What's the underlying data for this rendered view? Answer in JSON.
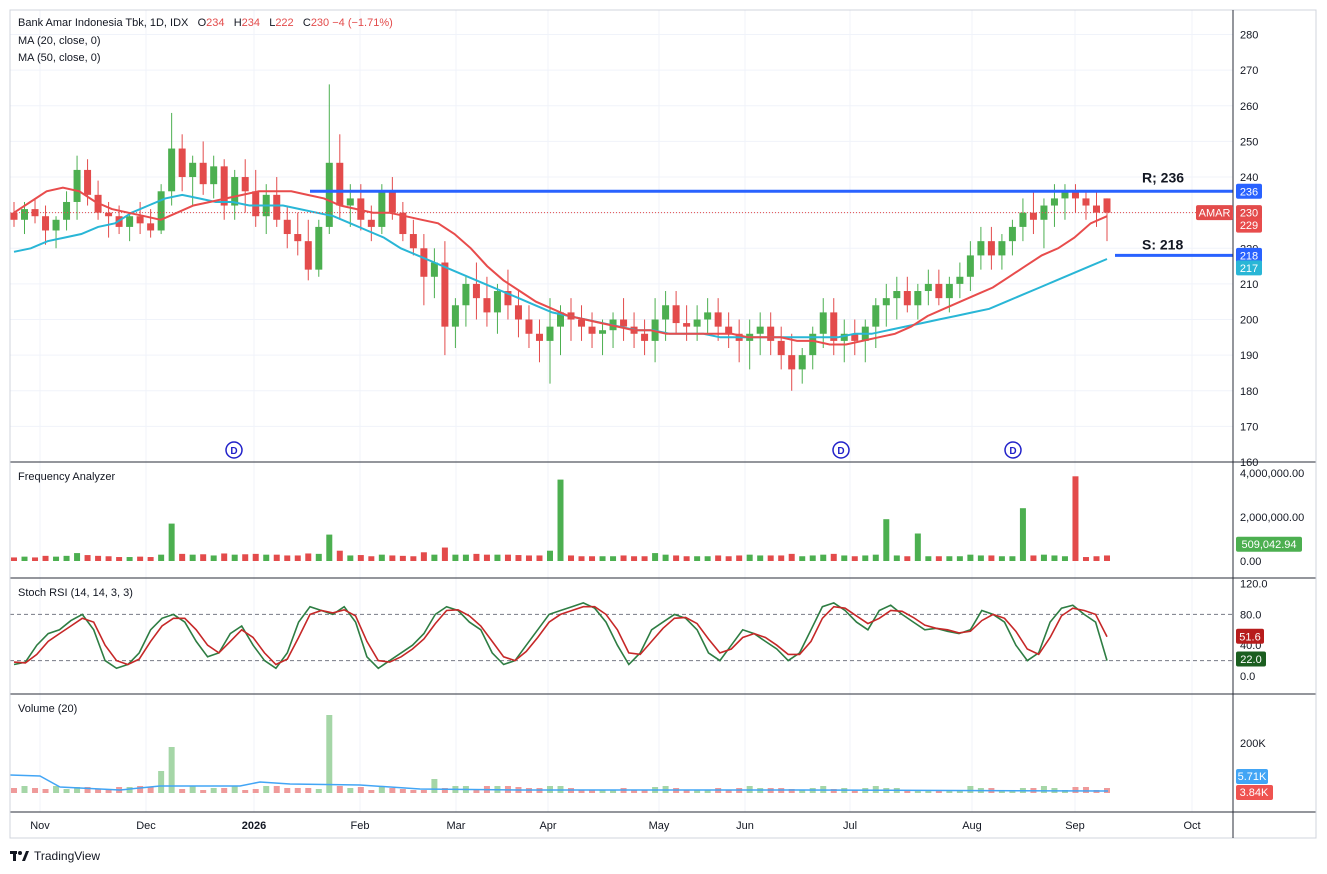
{
  "header": {
    "symbol_line": "Bank Amar Indonesia Tbk, 1D, IDX",
    "ohlc": [
      {
        "label": "O",
        "value": "234"
      },
      {
        "label": "H",
        "value": "234"
      },
      {
        "label": "L",
        "value": "222"
      },
      {
        "label": "C",
        "value": "230"
      }
    ],
    "change": "−4 (−1.71%)",
    "ma20_label": "MA (20, close, 0)",
    "ma50_label": "MA (50, close, 0)"
  },
  "panes": {
    "frequency_title": "Frequency Analyzer",
    "stoch_title": "Stoch RSI (14, 14, 3, 3)",
    "volume_title": "Volume (20)"
  },
  "brand": "TradingView",
  "colors": {
    "up": "#4caf50",
    "down": "#e34b4b",
    "ma20": "#e84c4c",
    "ma50": "#29b6d6",
    "level": "#2962ff",
    "stoch_k": "#2e7d43",
    "stoch_d": "#c62828",
    "vol_up": "#a5d6a7",
    "vol_down": "#ef9a9a"
  },
  "chart_data": {
    "type": "candlestick",
    "symbol": "AMAR",
    "x_ticks": [
      "Nov",
      "Dec",
      "2026",
      "Feb",
      "Mar",
      "Apr",
      "May",
      "Jun",
      "Jul",
      "Aug",
      "Sep",
      "Oct"
    ],
    "price_axis_ticks": [
      "280",
      "270",
      "260",
      "250",
      "240",
      "230",
      "220",
      "210",
      "200",
      "190",
      "180",
      "170",
      "160"
    ],
    "price_ylim": [
      160,
      285
    ],
    "last": {
      "close": 230,
      "ma20": 229,
      "ma50": 217
    },
    "price_badges": [
      {
        "text": "236",
        "kind": "resistance"
      },
      {
        "text": "AMAR",
        "kind": "symbol"
      },
      {
        "text": "230",
        "kind": "close"
      },
      {
        "text": "229",
        "kind": "ma20"
      },
      {
        "text": "218",
        "kind": "support"
      },
      {
        "text": "217",
        "kind": "ma50"
      }
    ],
    "levels": [
      {
        "label": "R; 236",
        "value": 236
      },
      {
        "label": "S: 218",
        "value": 218
      }
    ],
    "dividend_markers": {
      "label": "D",
      "months": [
        "Dec",
        "Jun",
        "Aug"
      ]
    },
    "ma20_path": [
      230,
      233,
      236,
      237,
      236,
      233,
      231,
      230,
      229,
      228,
      230,
      232,
      233,
      234,
      235,
      236,
      236,
      236,
      235,
      234,
      232,
      231,
      230,
      230,
      229,
      228,
      227,
      224,
      220,
      215,
      211,
      208,
      205,
      203,
      201,
      200,
      199,
      198,
      197,
      197,
      196,
      196,
      196,
      196,
      196,
      195,
      195,
      195,
      194,
      194,
      193,
      193,
      194,
      195,
      196,
      198,
      201,
      203,
      205,
      207,
      209,
      212,
      215,
      218,
      220,
      223,
      227,
      229
    ],
    "ma50_path": [
      219,
      220,
      222,
      223,
      224,
      226,
      227,
      230,
      232,
      234,
      235,
      234,
      233,
      233,
      232,
      232,
      232,
      231,
      230,
      229,
      227,
      225,
      223,
      220,
      218,
      216,
      214,
      212,
      210,
      208,
      206,
      204,
      202,
      201,
      200,
      199,
      198,
      197,
      197,
      196,
      196,
      196,
      195,
      195,
      195,
      195,
      195,
      195,
      195,
      195,
      196,
      196,
      197,
      198,
      199,
      200,
      201,
      202,
      203,
      205,
      207,
      209,
      211,
      213,
      215,
      217
    ],
    "ohlc_series": [
      [
        230,
        233,
        226,
        228
      ],
      [
        228,
        233,
        224,
        231
      ],
      [
        231,
        234,
        227,
        229
      ],
      [
        229,
        232,
        221,
        225
      ],
      [
        225,
        229,
        220,
        228
      ],
      [
        228,
        236,
        225,
        233
      ],
      [
        233,
        246,
        228,
        242
      ],
      [
        242,
        245,
        232,
        235
      ],
      [
        235,
        239,
        228,
        230
      ],
      [
        230,
        233,
        223,
        229
      ],
      [
        229,
        232,
        224,
        226
      ],
      [
        226,
        230,
        222,
        229
      ],
      [
        229,
        233,
        224,
        227
      ],
      [
        227,
        231,
        223,
        225
      ],
      [
        225,
        238,
        224,
        236
      ],
      [
        236,
        258,
        232,
        248
      ],
      [
        248,
        252,
        236,
        240
      ],
      [
        240,
        246,
        232,
        244
      ],
      [
        244,
        250,
        235,
        238
      ],
      [
        238,
        246,
        234,
        243
      ],
      [
        243,
        245,
        228,
        232
      ],
      [
        232,
        242,
        228,
        240
      ],
      [
        240,
        245,
        230,
        236
      ],
      [
        236,
        242,
        226,
        229
      ],
      [
        229,
        238,
        224,
        235
      ],
      [
        235,
        240,
        226,
        228
      ],
      [
        228,
        232,
        220,
        224
      ],
      [
        224,
        230,
        218,
        222
      ],
      [
        222,
        228,
        211,
        214
      ],
      [
        214,
        228,
        212,
        226
      ],
      [
        226,
        266,
        224,
        244
      ],
      [
        244,
        252,
        228,
        232
      ],
      [
        232,
        238,
        226,
        234
      ],
      [
        234,
        238,
        225,
        228
      ],
      [
        228,
        232,
        222,
        226
      ],
      [
        226,
        238,
        224,
        236
      ],
      [
        236,
        240,
        228,
        230
      ],
      [
        230,
        233,
        222,
        224
      ],
      [
        224,
        228,
        218,
        220
      ],
      [
        220,
        224,
        204,
        212
      ],
      [
        212,
        220,
        206,
        216
      ],
      [
        216,
        222,
        190,
        198
      ],
      [
        198,
        206,
        192,
        204
      ],
      [
        204,
        212,
        198,
        210
      ],
      [
        210,
        216,
        200,
        206
      ],
      [
        206,
        212,
        198,
        202
      ],
      [
        202,
        210,
        196,
        208
      ],
      [
        208,
        214,
        200,
        204
      ],
      [
        204,
        208,
        195,
        200
      ],
      [
        200,
        204,
        192,
        196
      ],
      [
        196,
        200,
        188,
        194
      ],
      [
        194,
        206,
        182,
        198
      ],
      [
        198,
        204,
        190,
        202
      ],
      [
        202,
        206,
        194,
        200
      ],
      [
        200,
        204,
        194,
        198
      ],
      [
        198,
        202,
        192,
        196
      ],
      [
        196,
        200,
        190,
        197
      ],
      [
        197,
        202,
        192,
        200
      ],
      [
        200,
        206,
        194,
        198
      ],
      [
        198,
        202,
        192,
        196
      ],
      [
        196,
        200,
        190,
        194
      ],
      [
        194,
        206,
        188,
        200
      ],
      [
        200,
        208,
        194,
        204
      ],
      [
        204,
        208,
        196,
        199
      ],
      [
        199,
        204,
        194,
        198
      ],
      [
        198,
        204,
        194,
        200
      ],
      [
        200,
        206,
        196,
        202
      ],
      [
        202,
        206,
        194,
        198
      ],
      [
        198,
        202,
        192,
        196
      ],
      [
        196,
        200,
        188,
        194
      ],
      [
        194,
        200,
        186,
        196
      ],
      [
        196,
        202,
        190,
        198
      ],
      [
        198,
        202,
        190,
        194
      ],
      [
        194,
        198,
        186,
        190
      ],
      [
        190,
        196,
        180,
        186
      ],
      [
        186,
        192,
        182,
        190
      ],
      [
        190,
        198,
        186,
        196
      ],
      [
        196,
        206,
        192,
        202
      ],
      [
        202,
        206,
        190,
        194
      ],
      [
        194,
        200,
        188,
        196
      ],
      [
        196,
        200,
        190,
        194
      ],
      [
        194,
        200,
        188,
        198
      ],
      [
        198,
        206,
        192,
        204
      ],
      [
        204,
        210,
        198,
        206
      ],
      [
        206,
        212,
        200,
        208
      ],
      [
        208,
        212,
        202,
        204
      ],
      [
        204,
        210,
        200,
        208
      ],
      [
        208,
        214,
        204,
        210
      ],
      [
        210,
        214,
        204,
        206
      ],
      [
        206,
        212,
        202,
        210
      ],
      [
        210,
        216,
        206,
        212
      ],
      [
        212,
        222,
        208,
        218
      ],
      [
        218,
        226,
        214,
        222
      ],
      [
        222,
        226,
        214,
        218
      ],
      [
        218,
        224,
        214,
        222
      ],
      [
        222,
        228,
        218,
        226
      ],
      [
        226,
        234,
        222,
        230
      ],
      [
        230,
        236,
        224,
        228
      ],
      [
        228,
        234,
        220,
        232
      ],
      [
        232,
        238,
        226,
        234
      ],
      [
        234,
        238,
        228,
        236
      ],
      [
        236,
        238,
        230,
        234
      ],
      [
        234,
        236,
        228,
        232
      ],
      [
        232,
        236,
        226,
        230
      ],
      [
        234,
        234,
        222,
        230
      ]
    ],
    "frequency_axis_ticks": [
      "4,000,000.00",
      "2,000,000.00",
      "0.00"
    ],
    "frequency_last": "509,042.94",
    "stoch_axis_ticks": [
      "120.0",
      "80.0",
      "40.0",
      "0.0"
    ],
    "stoch_last": {
      "k": "22.0",
      "d": "51.6"
    },
    "stoch_k": [
      15,
      18,
      40,
      55,
      60,
      72,
      80,
      60,
      20,
      10,
      15,
      30,
      60,
      75,
      80,
      70,
      45,
      25,
      30,
      55,
      65,
      40,
      20,
      10,
      30,
      70,
      90,
      85,
      80,
      90,
      70,
      25,
      10,
      20,
      30,
      40,
      55,
      80,
      90,
      85,
      70,
      60,
      30,
      15,
      20,
      40,
      60,
      80,
      85,
      90,
      95,
      88,
      70,
      40,
      15,
      30,
      60,
      70,
      80,
      75,
      60,
      30,
      20,
      40,
      60,
      55,
      45,
      35,
      20,
      30,
      60,
      90,
      95,
      85,
      70,
      60,
      85,
      92,
      80,
      70,
      60,
      62,
      58,
      55,
      60,
      85,
      80,
      70,
      40,
      20,
      30,
      70,
      88,
      92,
      80,
      70,
      20
    ],
    "stoch_d": [
      18,
      17,
      28,
      45,
      55,
      65,
      75,
      70,
      40,
      20,
      15,
      22,
      45,
      65,
      75,
      75,
      60,
      40,
      30,
      45,
      60,
      50,
      30,
      15,
      22,
      50,
      80,
      85,
      82,
      86,
      78,
      45,
      20,
      18,
      25,
      35,
      48,
      68,
      85,
      86,
      78,
      65,
      45,
      25,
      20,
      32,
      50,
      70,
      80,
      85,
      90,
      90,
      80,
      60,
      30,
      28,
      45,
      62,
      75,
      76,
      68,
      48,
      30,
      35,
      50,
      55,
      50,
      40,
      28,
      28,
      45,
      75,
      90,
      88,
      78,
      68,
      75,
      85,
      84,
      76,
      66,
      62,
      60,
      56,
      58,
      72,
      80,
      75,
      58,
      35,
      28,
      50,
      78,
      88,
      85,
      80,
      51
    ]
  }
}
